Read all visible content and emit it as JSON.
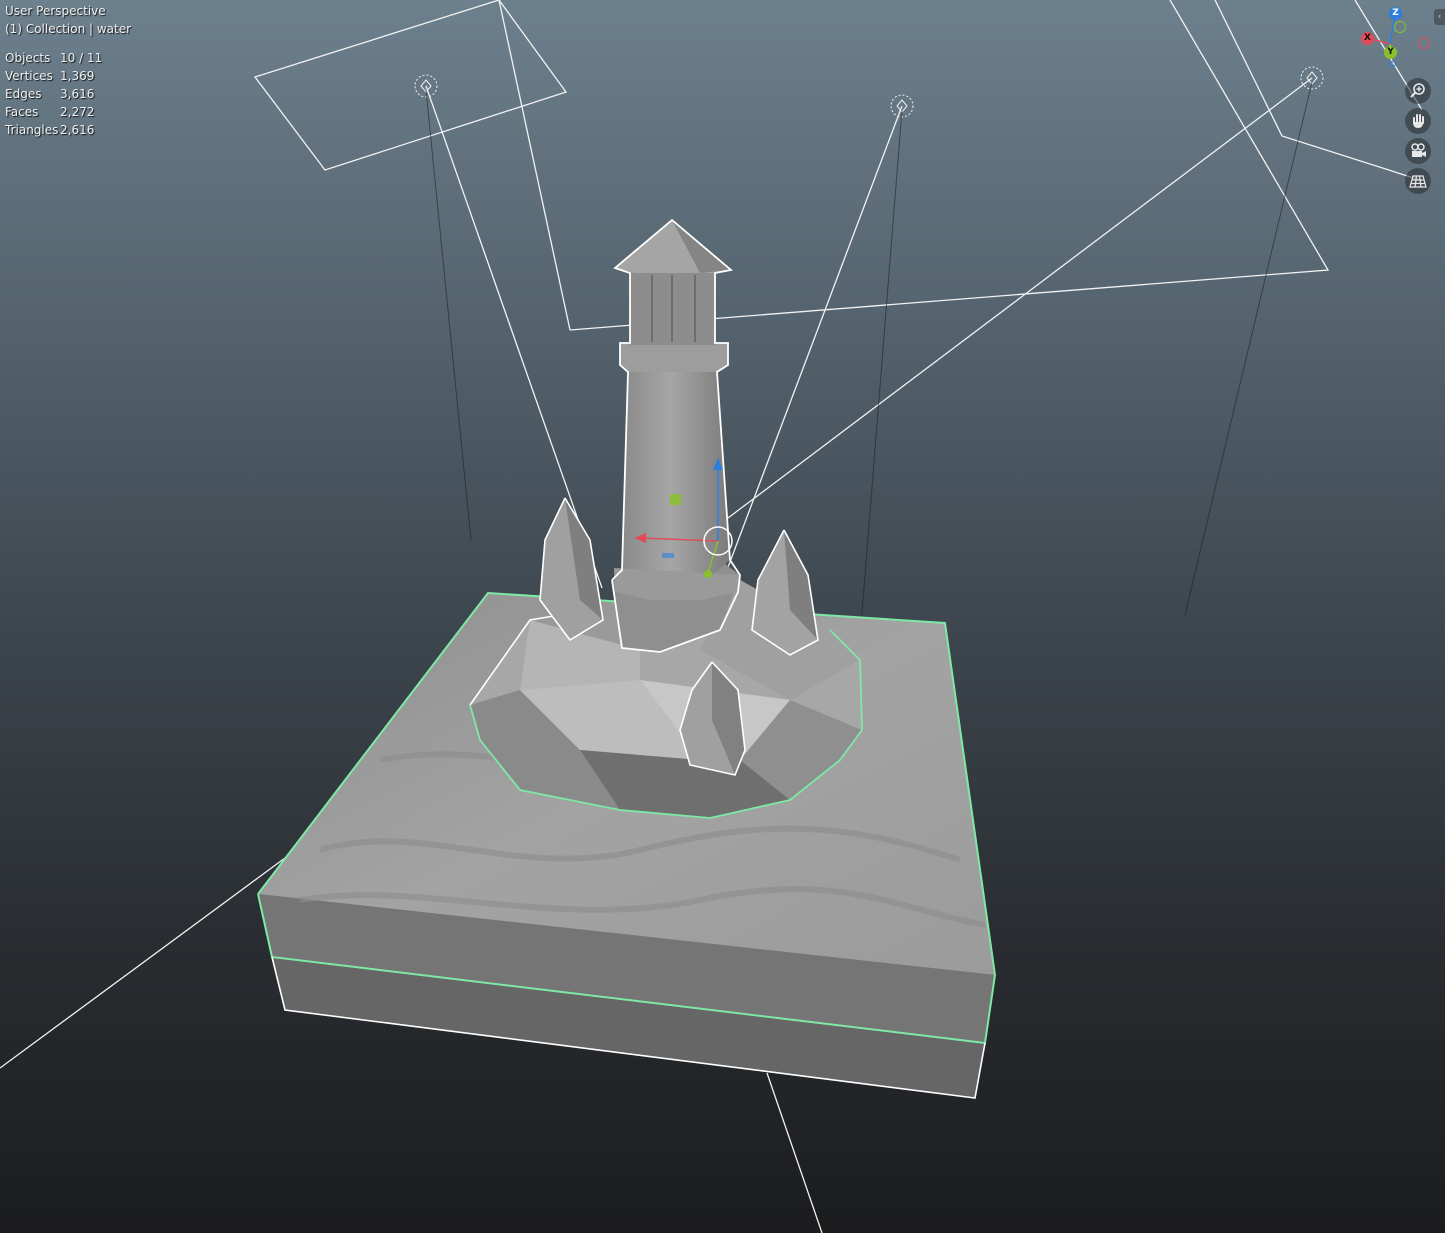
{
  "viewport": {
    "title": "User Perspective",
    "collection": "(1) Collection | water"
  },
  "stats": [
    {
      "label": "Objects",
      "value": "10 / 11"
    },
    {
      "label": "Vertices",
      "value": "1,369"
    },
    {
      "label": "Edges",
      "value": "3,616"
    },
    {
      "label": "Faces",
      "value": "2,272"
    },
    {
      "label": "Triangles",
      "value": "2,616"
    }
  ],
  "gizmo": {
    "z_label": "Z",
    "x_label": "X",
    "y_label": "Y",
    "colors": {
      "x": "#e24c5a",
      "y": "#8bc02c",
      "z": "#2c7fe0"
    }
  },
  "nav_buttons": [
    {
      "name": "zoom-icon"
    },
    {
      "name": "hand-pan-icon"
    },
    {
      "name": "camera-icon"
    },
    {
      "name": "grid-icon"
    }
  ],
  "colors": {
    "selection_outline": "#7ee8a6",
    "active_outline": "#ffffff",
    "mesh_gray": "#9a9a9a"
  }
}
